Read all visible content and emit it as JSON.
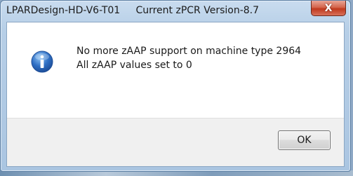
{
  "dialog": {
    "title": "LPARDesign-HD-V6-T01     Current zPCR Version-8.7",
    "close_glyph": "X",
    "message_lines": [
      "No more zAAP support on machine type 2964",
      "All zAAP values set to 0"
    ],
    "ok_label": "OK",
    "icon": "info-icon"
  },
  "colors": {
    "title_bar": "#b7cfe7",
    "close_button": "#c0391d",
    "info_icon": "#2f6fc4",
    "button_area": "#f0f0f0"
  }
}
